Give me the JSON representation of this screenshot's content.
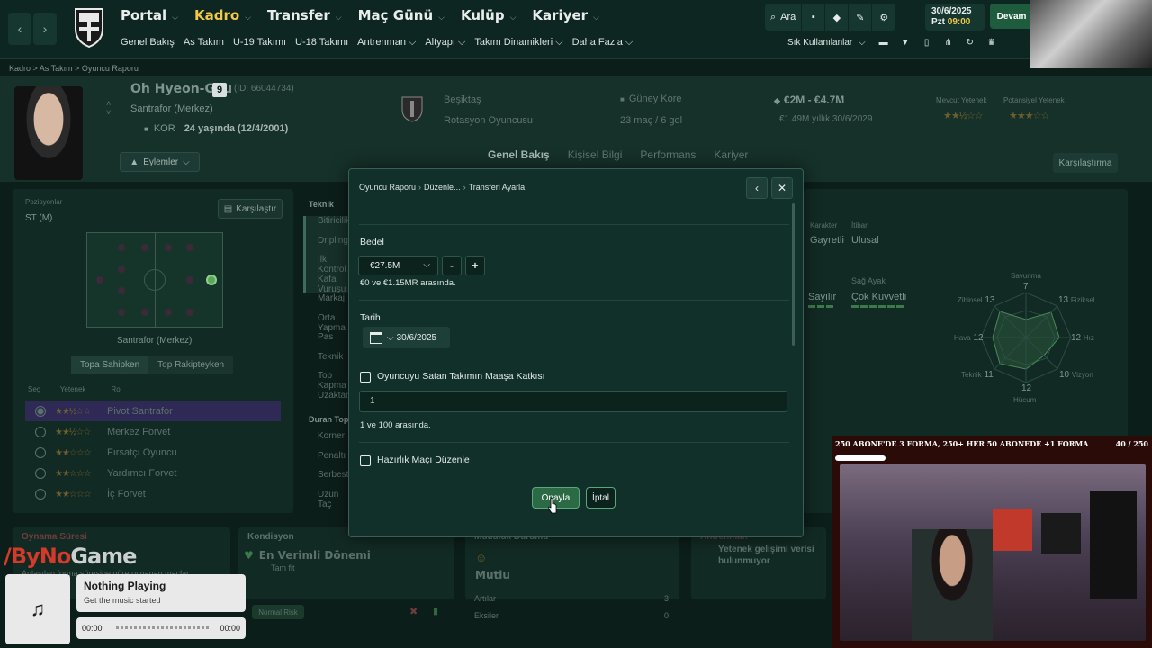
{
  "nav": {
    "back": "‹",
    "forward": "›",
    "menu": [
      {
        "label": "Portal",
        "active": false
      },
      {
        "label": "Kadro",
        "active": true
      },
      {
        "label": "Transfer",
        "active": false
      },
      {
        "label": "Maç Günü",
        "active": false
      },
      {
        "label": "Kulüp",
        "active": false
      },
      {
        "label": "Kariyer",
        "active": false
      }
    ],
    "submenu": [
      "Genel Bakış",
      "As Takım",
      "U-19 Takımı",
      "U-18 Takımı",
      "Antrenman ⌵",
      "Altyapı ⌵",
      "Takım Dinamikleri ⌵",
      "Daha Fazla ⌵"
    ],
    "search_label": "Ara",
    "date": "30/6/2025",
    "day_time_prefix": "Pzt",
    "time": "09:00",
    "continue_label": "Devam",
    "shortcuts_label": "Sık Kullanılanlar"
  },
  "breadcrumb": "Kadro  >  As Takım  >  Oyuncu Raporu",
  "player": {
    "name": "Oh Hyeon-Gyu",
    "number": "9",
    "id_text": "(ID: 66044734)",
    "position": "Santrafor (Merkez)",
    "nation_code": "KOR",
    "age_text": "24 yaşında (12/4/2001)",
    "actions_label": "Eylemler",
    "club": "Beşiktaş",
    "squad_status": "Rotasyon Oyuncusu",
    "nation": "Güney Kore",
    "caps": "23 maç / 6 gol",
    "value_range": "€2M - €4.7M",
    "wage": "€1.49M yıllık 30/6/2029",
    "current_ability_label": "Mevcut Yetenek",
    "potential_ability_label": "Potansiyel Yetenek",
    "current_stars": "★★½☆☆",
    "potential_stars": "★★★☆☆",
    "tabs": [
      "Genel Bakış",
      "Kişisel Bilgi",
      "Performans",
      "Kariyer"
    ],
    "compare_label": "Karşılaştırma"
  },
  "left": {
    "positions_label": "Pozisyonlar",
    "position_value": "ST (M)",
    "compare_btn": "Karşılaştır",
    "pitch_caption": "Santrafor (Merkez)",
    "tab_on": "Topa Sahipken",
    "tab_off": "Top Rakipteyken",
    "role_headers": [
      "Seç",
      "Yetenek",
      "Rol"
    ],
    "roles": [
      {
        "stars": "★★½☆☆",
        "name": "Pivot Santrafor",
        "selected": true
      },
      {
        "stars": "★★½☆☆",
        "name": "Merkez Forvet",
        "selected": false
      },
      {
        "stars": "★★☆☆☆",
        "name": "Fırsatçı Oyuncu",
        "selected": false
      },
      {
        "stars": "★★☆☆☆",
        "name": "Yardımcı Forvet",
        "selected": false
      },
      {
        "stars": "★★☆☆☆",
        "name": "İç Forvet",
        "selected": false
      }
    ]
  },
  "teknik": {
    "header": "Teknik",
    "rows": [
      "Bitiricilik",
      "Dripling",
      "İlk Kontrol",
      "Kafa Vuruşu",
      "Markaj",
      "Orta Yapma",
      "Pas",
      "Teknik",
      "Top Kapma",
      "Uzaktan"
    ],
    "header2": "Duran Top",
    "rows2": [
      "Korner",
      "Penaltı",
      "Serbest",
      "Uzun Taç"
    ]
  },
  "right": {
    "karakter_label": "Karakter",
    "karakter": "Gayretli",
    "itibar_label": "İtibar",
    "itibar": "Ulusal",
    "sag_ayak_label": "Sağ Ayak",
    "sag_ayak": "Çok Kuvvetli",
    "sol_ayak": "Sayılır",
    "radar": {
      "savunma_label": "Savunma",
      "savunma": "7",
      "fiziksel_label": "Fiziksel",
      "fiziksel": "13",
      "hiz_label": "Hız",
      "hiz": "12",
      "vizyon_label": "Vizyon",
      "vizyon": "10",
      "hucum_label": "Hücum",
      "hucum": "12",
      "teknik_label": "Teknik",
      "teknik": "11",
      "hava_label": "Hava",
      "hava": "12",
      "zihinsel_label": "Zihinsel",
      "zihinsel": "13"
    }
  },
  "cards": {
    "oynama_title": "Oynama Süresi",
    "oynama_text": "Anlaşılan forma süresine göre oynanan maçlar",
    "kondisyon_title": "Kondisyon",
    "kondisyon_value": "En Verimli Dönemi",
    "kondisyon_sub": "Tam fit",
    "risk": "Normal Risk",
    "moral_title": "Mutluluk Durumu",
    "moral_value": "Mutlu",
    "artilar_label": "Artılar",
    "artilar_value": "3",
    "eksiler_label": "Eksiler",
    "eksiler_value": "0",
    "antrenman_title": "Antrenman",
    "antrenman_text": "Yetenek gelişimi verisi bulunmuyor"
  },
  "modal": {
    "crumbs": [
      "Oyuncu Raporu",
      "Düzenle...",
      "Transferi Ayarla"
    ],
    "fee_label": "Bedel",
    "fee_value": "€27.5M",
    "fee_hint": "€0 ve €1.15MR arasında.",
    "date_label": "Tarih",
    "date_value": "30/6/2025",
    "wage_share_label": "Oyuncuyu Satan Takımın Maaşa Katkısı",
    "wage_share_value": "1",
    "wage_share_hint": "1 ve 100 arasında.",
    "friendly_label": "Hazırlık Maçı Düzenle",
    "confirm_label": "Onayla",
    "cancel_label": "İptal"
  },
  "overlay": {
    "banner_text": "250 ABONE'DE 3 FORMA, 250+ HER 50 ABONEDE +1 FORMA",
    "banner_count": "40 / 250",
    "banner_progress": 0.16,
    "watermark_pre": "/ByNo",
    "watermark_post": "Game",
    "music_title": "Nothing Playing",
    "music_sub": "Get the music started",
    "time_start": "00:00",
    "time_end": "00:00"
  }
}
